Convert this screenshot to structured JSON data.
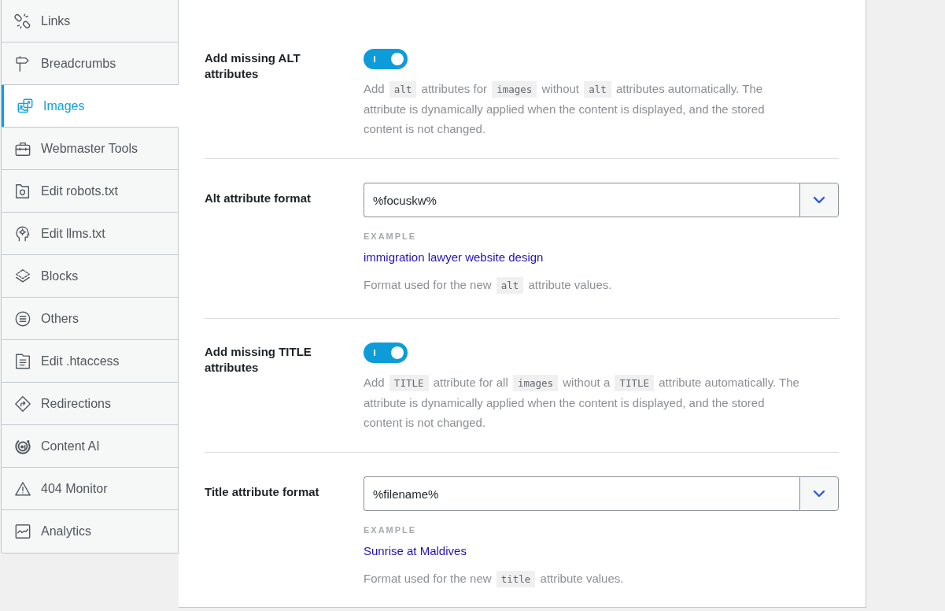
{
  "sidebar": {
    "items": [
      {
        "label": "Links",
        "selected": false
      },
      {
        "label": "Breadcrumbs",
        "selected": false
      },
      {
        "label": "Images",
        "selected": true
      },
      {
        "label": "Webmaster Tools",
        "selected": false
      },
      {
        "label": "Edit robots.txt",
        "selected": false
      },
      {
        "label": "Edit llms.txt",
        "selected": false
      },
      {
        "label": "Blocks",
        "selected": false
      },
      {
        "label": "Others",
        "selected": false
      },
      {
        "label": "Edit .htaccess",
        "selected": false
      },
      {
        "label": "Redirections",
        "selected": false
      },
      {
        "label": "Content AI",
        "selected": false
      },
      {
        "label": "404 Monitor",
        "selected": false
      },
      {
        "label": "Analytics",
        "selected": false
      }
    ]
  },
  "settings": [
    {
      "kind": "toggle",
      "label": "Add missing ALT attributes",
      "on": true,
      "description": [
        {
          "kind": "text",
          "text": "Add "
        },
        {
          "kind": "code",
          "text": "alt"
        },
        {
          "kind": "text",
          "text": " attributes for "
        },
        {
          "kind": "code",
          "text": "images"
        },
        {
          "kind": "text",
          "text": " without "
        },
        {
          "kind": "code",
          "text": "alt"
        },
        {
          "kind": "text",
          "text": " attributes automatically. The attribute is dynamically applied when the content is displayed, and the stored content is not changed."
        }
      ]
    },
    {
      "kind": "format",
      "label": "Alt attribute format",
      "value": "%focuskw%",
      "example_label": "EXAMPLE",
      "example": "immigration lawyer website design",
      "note": [
        {
          "kind": "text",
          "text": "Format used for the new "
        },
        {
          "kind": "code",
          "text": "alt"
        },
        {
          "kind": "text",
          "text": " attribute values."
        }
      ]
    },
    {
      "kind": "toggle",
      "label": "Add missing TITLE attributes",
      "on": true,
      "description": [
        {
          "kind": "text",
          "text": "Add "
        },
        {
          "kind": "code",
          "text": "TITLE"
        },
        {
          "kind": "text",
          "text": " attribute for all "
        },
        {
          "kind": "code",
          "text": "images"
        },
        {
          "kind": "text",
          "text": " without a "
        },
        {
          "kind": "code",
          "text": "TITLE"
        },
        {
          "kind": "text",
          "text": " attribute automatically. The attribute is dynamically applied when the content is displayed, and the stored content is not changed."
        }
      ]
    },
    {
      "kind": "format",
      "label": "Title attribute format",
      "value": "%filename%",
      "example_label": "EXAMPLE",
      "example": "Sunrise at Maldives",
      "note": [
        {
          "kind": "text",
          "text": "Format used for the new "
        },
        {
          "kind": "code",
          "text": "title"
        },
        {
          "kind": "text",
          "text": " attribute values."
        }
      ]
    }
  ]
}
